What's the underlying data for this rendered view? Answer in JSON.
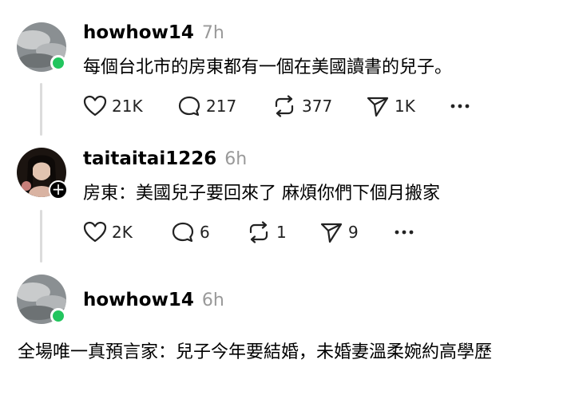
{
  "posts": [
    {
      "username": "howhow14",
      "time": "7h",
      "text": "每個台北市的房東都有一個在美國讀書的兒子。",
      "likes": "21K",
      "comments": "217",
      "reposts": "377",
      "shares": "1K",
      "avatar_badge": "online-dot"
    },
    {
      "username": "taitaitai1226",
      "time": "6h",
      "text": "房東：美國兒子要回來了 麻煩你們下個月搬家",
      "likes": "2K",
      "comments": "6",
      "reposts": "1",
      "shares": "9",
      "avatar_badge": "follow-plus",
      "follow_symbol": "+"
    },
    {
      "username": "howhow14",
      "time": "6h",
      "text": "全場唯一真預言家：兒子今年要結婚，未婚妻溫柔婉約高學歷",
      "avatar_badge": "online-dot"
    }
  ],
  "icons": {
    "like": "heart-icon",
    "comment": "comment-bubble-icon",
    "repost": "repost-icon",
    "share": "send-icon",
    "more": "more-dots-icon"
  },
  "colors": {
    "online": "#22c55e",
    "time": "#999999",
    "thread_line": "#dcdcdc"
  }
}
